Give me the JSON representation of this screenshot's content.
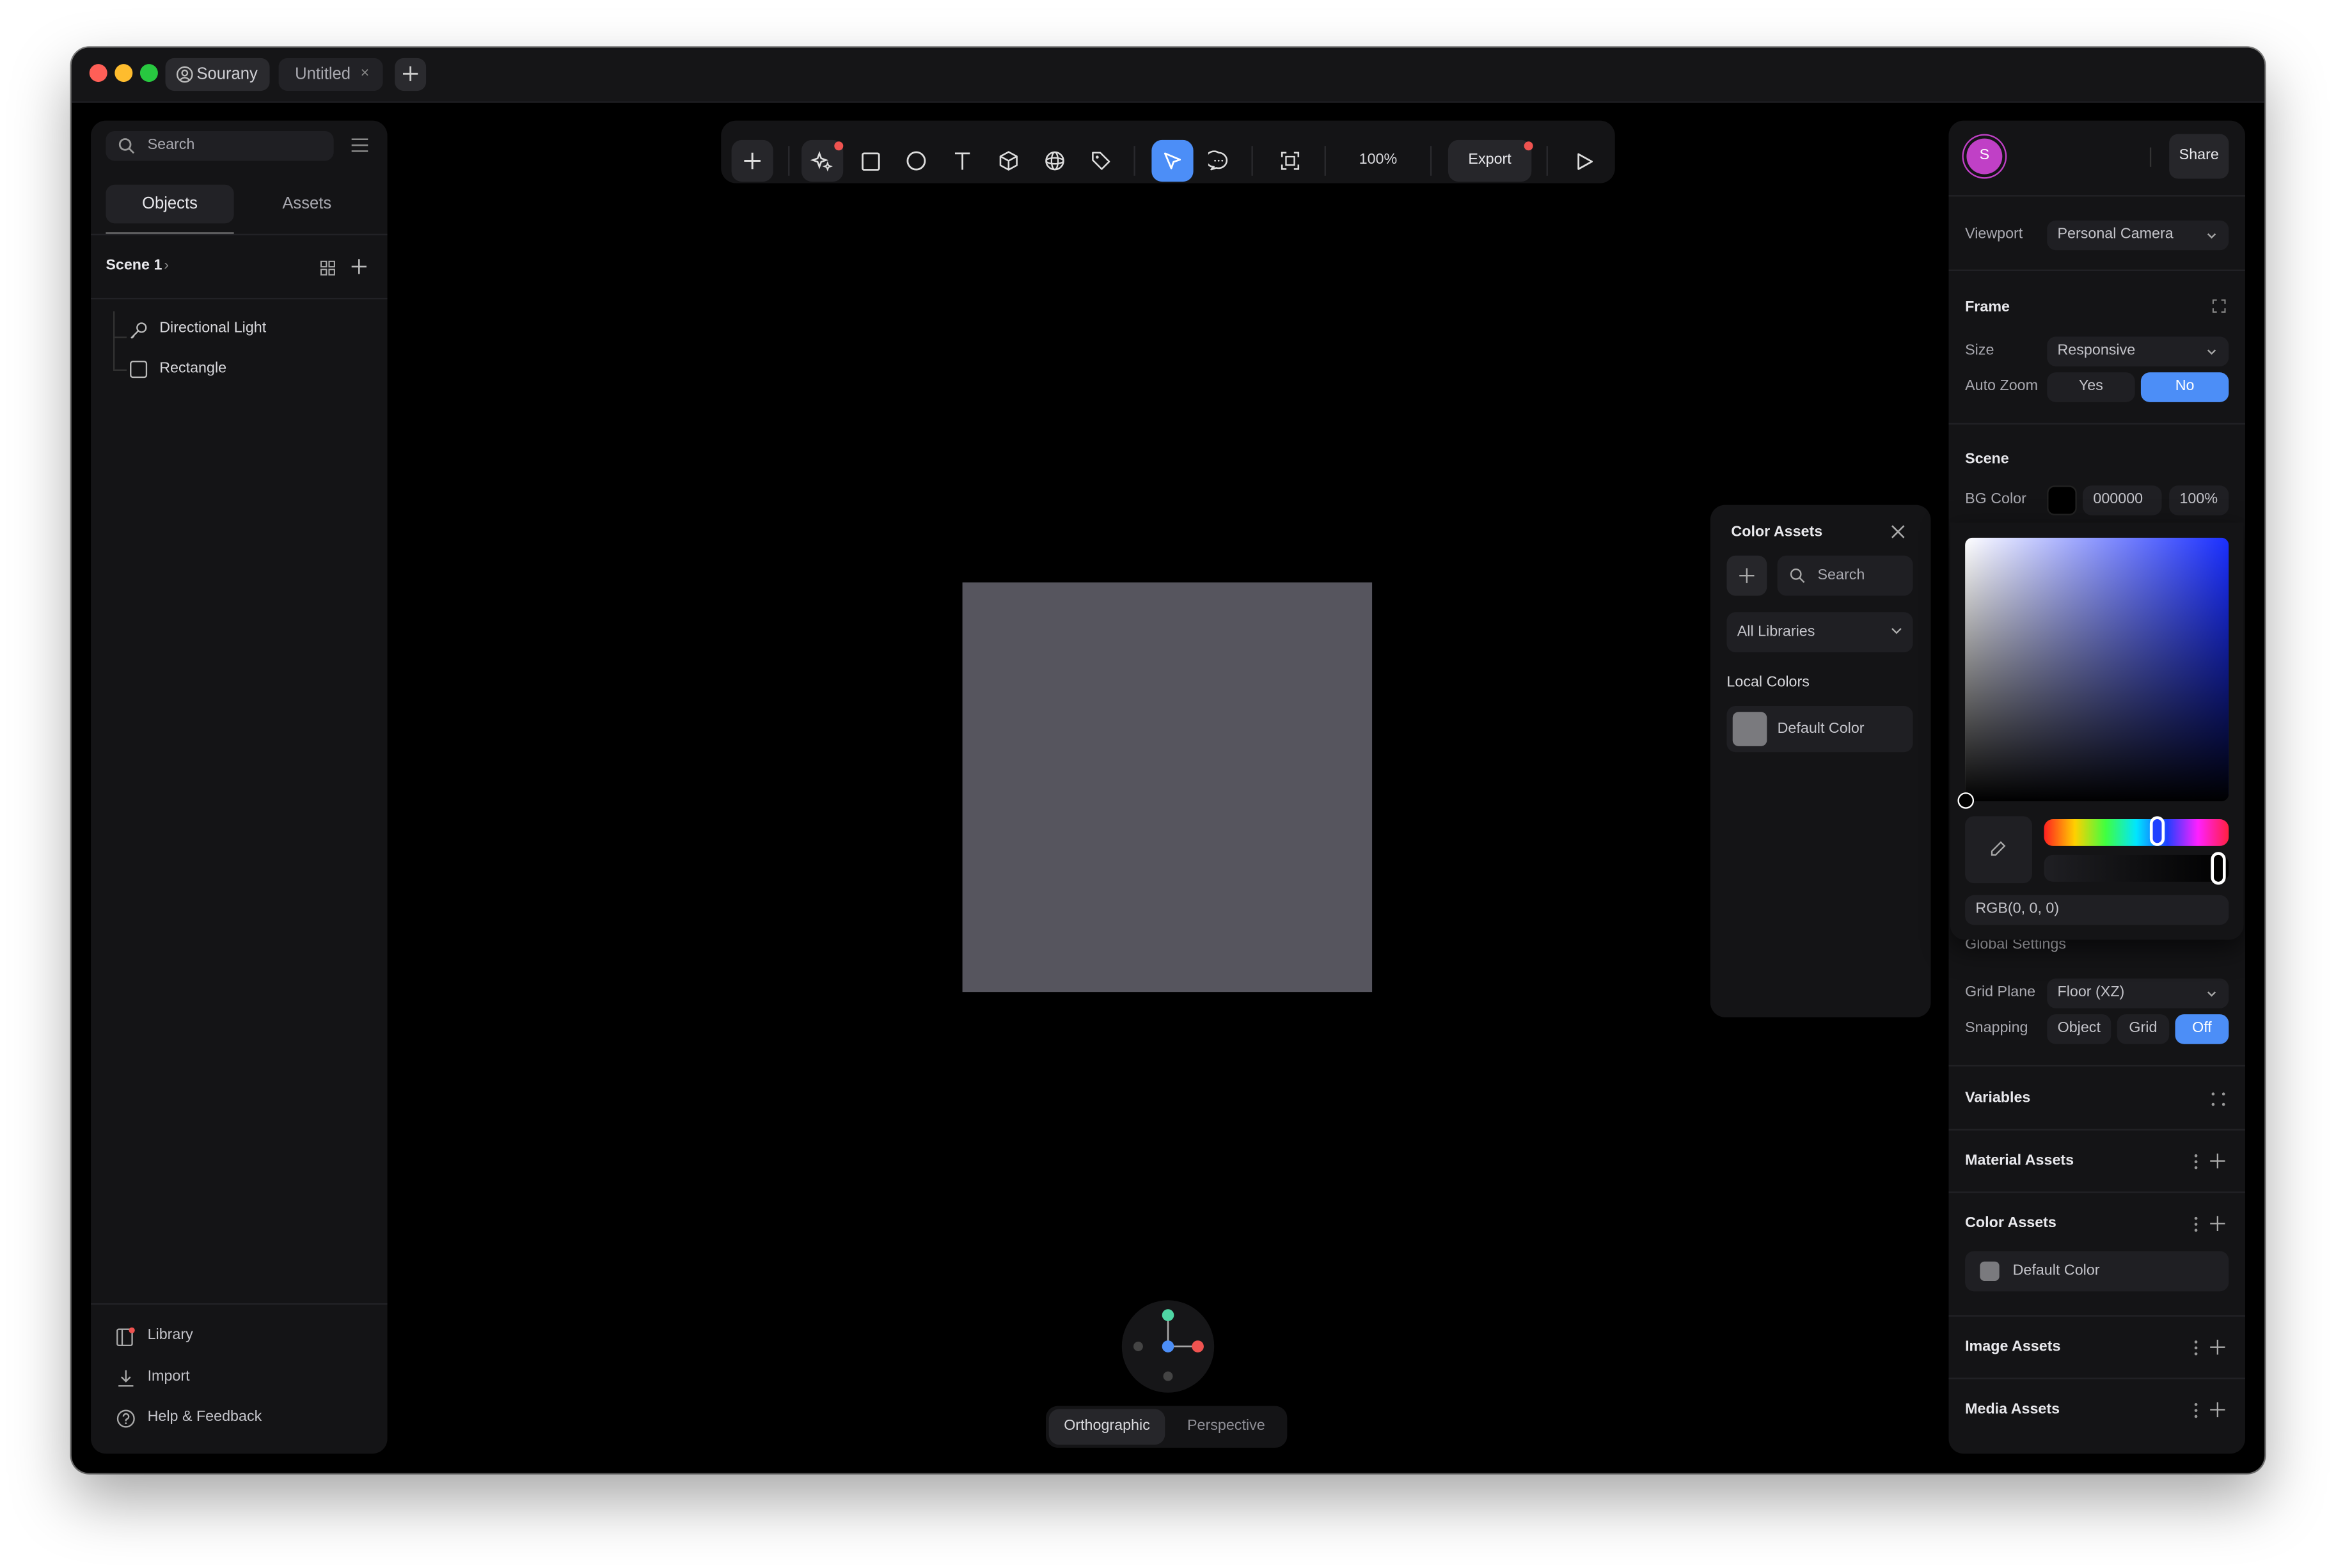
{
  "titlebar": {
    "user_tab": "Sourany",
    "file_tab": "Untitled"
  },
  "left_panel": {
    "search_placeholder": "Search",
    "tabs": [
      "Objects",
      "Assets"
    ],
    "active_tab": "Objects",
    "scene_name": "Scene 1",
    "layers": [
      "Directional Light",
      "Rectangle"
    ],
    "footer": [
      "Library",
      "Import",
      "Help & Feedback"
    ]
  },
  "toolbar": {
    "zoom": "100%",
    "export_label": "Export"
  },
  "canvas": {
    "rectangle_color": "#56555e",
    "view_modes": [
      "Orthographic",
      "Perspective"
    ],
    "active_view_mode": "Orthographic"
  },
  "color_assets_popup": {
    "title": "Color Assets",
    "search_placeholder": "Search",
    "library_filter": "All Libraries",
    "section": "Local Colors",
    "items": [
      {
        "name": "Default Color",
        "color": "#7a7a7e"
      }
    ]
  },
  "right_panel": {
    "avatar_initial": "S",
    "share_label": "Share",
    "viewport_label": "Viewport",
    "viewport_value": "Personal Camera",
    "frame_title": "Frame",
    "size_label": "Size",
    "size_value": "Responsive",
    "auto_zoom_label": "Auto Zoom",
    "auto_zoom_options": [
      "Yes",
      "No"
    ],
    "auto_zoom_selected": "No",
    "scene_title": "Scene",
    "bg_color_label": "BG Color",
    "bg_color_hex": "000000",
    "bg_color_opacity": "100%",
    "color_picker_value": "RGB(0, 0, 0)",
    "global_settings_title": "Global Settings",
    "grid_plane_label": "Grid Plane",
    "grid_plane_value": "Floor (XZ)",
    "snapping_label": "Snapping",
    "snapping_options": [
      "Object",
      "Grid",
      "Off"
    ],
    "snapping_selected": "Off",
    "variables_title": "Variables",
    "material_assets_title": "Material Assets",
    "color_assets_title": "Color Assets",
    "color_assets_item": "Default Color",
    "image_assets_title": "Image Assets",
    "media_assets_title": "Media Assets"
  },
  "colors": {
    "accent": "#4c8ef7",
    "background": "#000000",
    "panel": "#141416",
    "notification_dot": "#ef5350"
  }
}
